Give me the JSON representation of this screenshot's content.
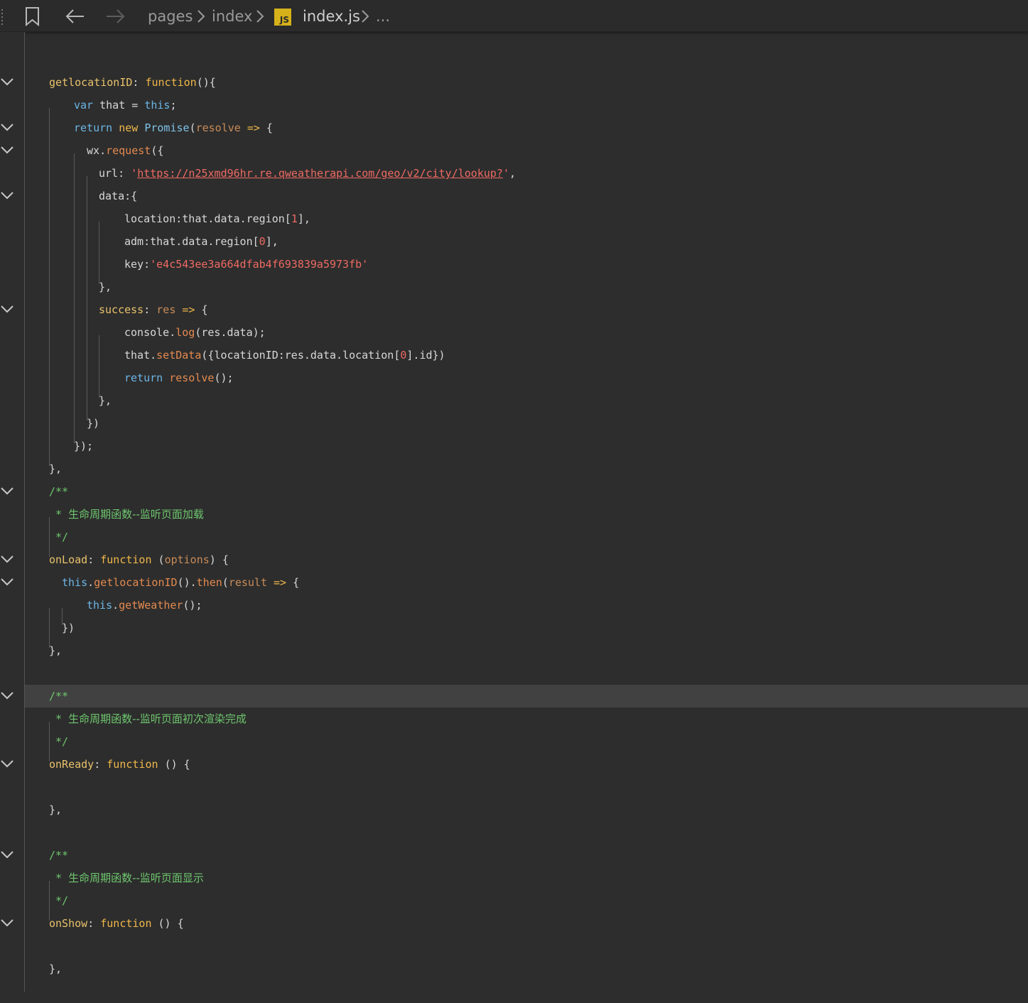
{
  "breadcrumb": {
    "items": [
      "pages",
      "index",
      "index.js",
      "..."
    ],
    "file_badge": "JS"
  },
  "editor": {
    "current_line_index": 28,
    "lines": [
      [],
      [
        [
          "pr",
          "getlocationID"
        ],
        [
          "op",
          ": "
        ],
        [
          "kw",
          "function"
        ],
        [
          "op",
          "(){"
        ]
      ],
      [
        [
          "bl",
          "var"
        ],
        [
          "tx",
          " that "
        ],
        [
          "op",
          "= "
        ],
        [
          "bl",
          "this"
        ],
        [
          "op",
          ";"
        ]
      ],
      [
        [
          "bl",
          "return "
        ],
        [
          "kw",
          "new "
        ],
        [
          "cls",
          "Promise"
        ],
        [
          "op",
          "("
        ],
        [
          "pa",
          "resolve"
        ],
        [
          "op",
          " "
        ],
        [
          "kw",
          "=>"
        ],
        [
          "op",
          " {"
        ]
      ],
      [
        [
          "tx",
          "wx"
        ],
        [
          "op",
          "."
        ],
        [
          "fn",
          "request"
        ],
        [
          "op",
          "({"
        ]
      ],
      [
        [
          "tx",
          "url"
        ],
        [
          "op",
          ": "
        ],
        [
          "st",
          "'"
        ],
        [
          "url",
          "https://n25xmd96hr.re.qweatherapi.com/geo/v2/city/lookup?"
        ],
        [
          "st",
          "'"
        ],
        [
          "op",
          ","
        ]
      ],
      [
        [
          "tx",
          "data"
        ],
        [
          "op",
          ":{"
        ]
      ],
      [
        [
          "tx",
          "location"
        ],
        [
          "op",
          ":"
        ],
        [
          "tx",
          "that"
        ],
        [
          "op",
          "."
        ],
        [
          "tx",
          "data"
        ],
        [
          "op",
          "."
        ],
        [
          "tx",
          "region"
        ],
        [
          "op",
          "["
        ],
        [
          "nu",
          "1"
        ],
        [
          "op",
          "],"
        ]
      ],
      [
        [
          "tx",
          "adm"
        ],
        [
          "op",
          ":"
        ],
        [
          "tx",
          "that"
        ],
        [
          "op",
          "."
        ],
        [
          "tx",
          "data"
        ],
        [
          "op",
          "."
        ],
        [
          "tx",
          "region"
        ],
        [
          "op",
          "["
        ],
        [
          "nu",
          "0"
        ],
        [
          "op",
          "],"
        ]
      ],
      [
        [
          "tx",
          "key"
        ],
        [
          "op",
          ":"
        ],
        [
          "st",
          "'e4c543ee3a664dfab4f693839a5973fb'"
        ]
      ],
      [
        [
          "op",
          "},"
        ]
      ],
      [
        [
          "pr",
          "success"
        ],
        [
          "op",
          ": "
        ],
        [
          "pa",
          "res"
        ],
        [
          "op",
          " "
        ],
        [
          "kw",
          "=>"
        ],
        [
          "op",
          " {"
        ]
      ],
      [
        [
          "tx",
          "console"
        ],
        [
          "op",
          "."
        ],
        [
          "fn",
          "log"
        ],
        [
          "op",
          "("
        ],
        [
          "tx",
          "res"
        ],
        [
          "op",
          "."
        ],
        [
          "tx",
          "data"
        ],
        [
          "op",
          ");"
        ]
      ],
      [
        [
          "tx",
          "that"
        ],
        [
          "op",
          "."
        ],
        [
          "fn",
          "setData"
        ],
        [
          "op",
          "({"
        ],
        [
          "tx",
          "locationID"
        ],
        [
          "op",
          ":"
        ],
        [
          "tx",
          "res"
        ],
        [
          "op",
          "."
        ],
        [
          "tx",
          "data"
        ],
        [
          "op",
          "."
        ],
        [
          "tx",
          "location"
        ],
        [
          "op",
          "["
        ],
        [
          "nu",
          "0"
        ],
        [
          "op",
          "]."
        ],
        [
          "tx",
          "id"
        ],
        [
          "op",
          "})"
        ]
      ],
      [
        [
          "bl",
          "return "
        ],
        [
          "fn",
          "resolve"
        ],
        [
          "op",
          "();"
        ]
      ],
      [
        [
          "op",
          "},"
        ]
      ],
      [
        [
          "op",
          "})"
        ]
      ],
      [
        [
          "op",
          "});"
        ]
      ],
      [
        [
          "op",
          "},"
        ]
      ],
      [
        [
          "cmm",
          "/**"
        ]
      ],
      [
        [
          "cmm",
          "* "
        ],
        [
          "cm",
          "生命周期函数--监听页面加载"
        ]
      ],
      [
        [
          "cmm",
          "*/"
        ]
      ],
      [
        [
          "pr",
          "onLoad"
        ],
        [
          "op",
          ": "
        ],
        [
          "kw",
          "function "
        ],
        [
          "op",
          "("
        ],
        [
          "pa",
          "options"
        ],
        [
          "op",
          ") {"
        ]
      ],
      [
        [
          "bl",
          "this"
        ],
        [
          "op",
          "."
        ],
        [
          "fn",
          "getlocationID"
        ],
        [
          "op",
          "()."
        ],
        [
          "fn",
          "then"
        ],
        [
          "op",
          "("
        ],
        [
          "pa",
          "result"
        ],
        [
          "op",
          " "
        ],
        [
          "kw",
          "=>"
        ],
        [
          "op",
          " {"
        ]
      ],
      [
        [
          "bl",
          "this"
        ],
        [
          "op",
          "."
        ],
        [
          "fn",
          "getWeather"
        ],
        [
          "op",
          "();"
        ]
      ],
      [
        [
          "op",
          "})"
        ]
      ],
      [
        [
          "op",
          "},"
        ]
      ],
      [],
      [
        [
          "cmm",
          "/**"
        ]
      ],
      [
        [
          "cmm",
          "* "
        ],
        [
          "cm",
          "生命周期函数--监听页面初次渲染完成"
        ]
      ],
      [
        [
          "cmm",
          "*/"
        ]
      ],
      [
        [
          "pr",
          "onReady"
        ],
        [
          "op",
          ": "
        ],
        [
          "kw",
          "function "
        ],
        [
          "op",
          "() {"
        ]
      ],
      [],
      [
        [
          "op",
          "},"
        ]
      ],
      [],
      [
        [
          "cmm",
          "/**"
        ]
      ],
      [
        [
          "cmm",
          "* "
        ],
        [
          "cm",
          "生命周期函数--监听页面显示"
        ]
      ],
      [
        [
          "cmm",
          "*/"
        ]
      ],
      [
        [
          "pr",
          "onShow"
        ],
        [
          "op",
          ": "
        ],
        [
          "kw",
          "function "
        ],
        [
          "op",
          "() {"
        ]
      ],
      [],
      [
        [
          "op",
          "},"
        ]
      ],
      []
    ]
  }
}
